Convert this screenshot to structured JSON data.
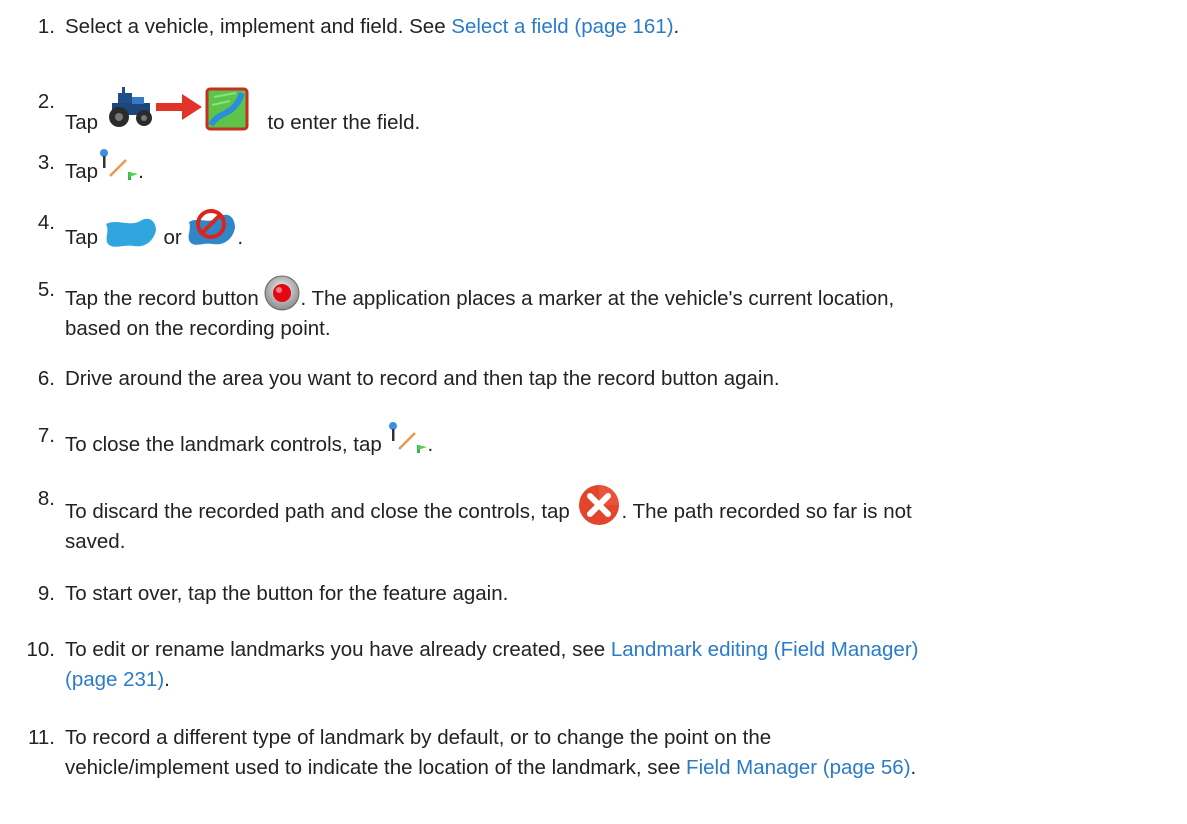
{
  "steps": [
    {
      "num": "1.",
      "before": "Select a vehicle, implement and field. See ",
      "link": "Select a field (page 161)",
      "after": "."
    },
    {
      "num": "2.",
      "before": "Tap",
      "after": "to enter the field.",
      "icon": "tractor-arrow-field-icon"
    },
    {
      "num": "3.",
      "before": "Tap",
      "after": ".",
      "icon": "landmark-controls-icon"
    },
    {
      "num": "4.",
      "before": "Tap",
      "middle": "or",
      "after": ".",
      "icons": [
        "area-landmark-icon",
        "exclusion-area-icon"
      ]
    },
    {
      "num": "5.",
      "before": "Tap the record button",
      "after": ". The application places a marker at the vehicle's current location,",
      "line2": "based on the recording point.",
      "icon": "record-button-icon"
    },
    {
      "num": "6.",
      "text": "Drive around the area you want to record and then tap the record button again."
    },
    {
      "num": "7.",
      "before": "To close the landmark controls, tap",
      "after": ".",
      "icon": "landmark-controls-icon"
    },
    {
      "num": "8.",
      "before": "To discard the recorded path and close the controls, tap",
      "after": ". The path recorded so far is not",
      "line2": "saved.",
      "icon": "discard-icon"
    },
    {
      "num": "9.",
      "text": "To start over, tap the button for the feature again."
    },
    {
      "num": "10.",
      "before": "To edit or rename landmarks you have already created, see ",
      "link": "Landmark editing (Field Manager)",
      "link2": "(page 231)",
      "after": "."
    },
    {
      "num": "11.",
      "line1": "To record a different type of landmark by default, or to change the point on the",
      "before": "vehicle/implement used to indicate the location of the landmark, see ",
      "link": "Field Manager (page 56)",
      "after": "."
    }
  ],
  "colors": {
    "link": "#2a7bc9",
    "text": "#222222",
    "record_red": "#e30613",
    "discard_red": "#e2452b",
    "area_blue": "#2fa6dd",
    "field_green": "#5cc44a"
  }
}
